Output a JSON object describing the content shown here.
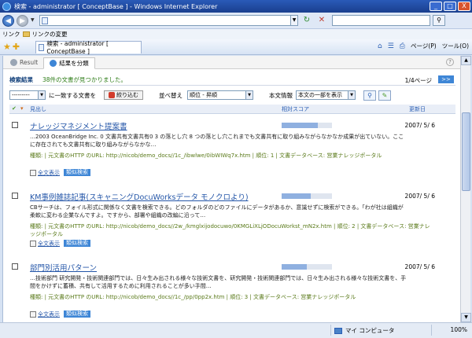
{
  "window": {
    "title": "検索 - administrator [ ConceptBase ] - Windows Internet Explorer",
    "minimize": "_",
    "maximize": "□",
    "close": "X"
  },
  "addressbar": {
    "back_icon": "back-arrow-icon",
    "url": "",
    "search_placeholder": ""
  },
  "linksbar": {
    "label": "リンク",
    "item": "リンクの変更"
  },
  "ie_tabs": {
    "active_tab": "検索 - administrator [ ConceptBase ]",
    "tools": [
      "ページ(P)",
      "ツール(O)"
    ]
  },
  "page_tabs": [
    {
      "label": "Result",
      "active": false
    },
    {
      "label": "結果を分類",
      "active": true
    }
  ],
  "summary": {
    "label": "検索結果",
    "message": "38件の文書が見つかりました。",
    "pages": "1/4ページ",
    "next": ">>"
  },
  "filters": {
    "match_select": "---------",
    "match_label": "に一致する文書を",
    "narrow_button": "絞り込む",
    "sort_label": "並べ替え",
    "sort_select": "順位 - 昇順",
    "body_label": "本文情報",
    "body_select": "本文の一部を表示"
  },
  "columns": {
    "heading": "見出し",
    "score": "相対スコア",
    "updated": "更新日"
  },
  "results": [
    {
      "title": "ナレッジマネジメント提案書",
      "score": 0.72,
      "date": "2007/ 5/ 6",
      "snippet": "…2003 OceanBridge Inc. 0 文書共有文書共有0 3 の落とし穴 8 つの落とし穴これまでも文書共有に取り組みながらなかなか成果が出ていない。ここに存在されても文書共有に取り組みながらなかな…",
      "meta": "種類: | 元文書のHTTP のURL: http://nicob/demo_docs//1c_/ibwlwe/0ibWIWq7x.htm | 順位: 1 | 文書データベース: 営業ナレッジポータル",
      "full_text": "全文表示",
      "similar": "類似検索"
    },
    {
      "title": "KM事例雑誌記事(スキャニングDocuWorksデータ モノクロより)",
      "score": 0.58,
      "date": "2007/ 5/ 6",
      "snippet": "CBサーチは、フォイル形式に関係なく文書を検索できる。どのフォルダのどのファイルにデータがあるか、意識せずに検索ができる。「わが社は組織が柔軟に変わる企業なんですよ。ですから、部署や組織の改編に沿って…",
      "meta": "種類: | 元文書のHTTP のURL: http://nicob/demo_docs//2w_/kmglxijodocuwo/0KMGLiXLjODocuWorkst_mN2x.htm | 順位: 2 | 文書データベース: 営業ナレッジポータル",
      "full_text": "全文表示",
      "similar": "類似検索"
    },
    {
      "title": "部門別活用パターン",
      "score": 0.5,
      "date": "2007/ 5/ 6",
      "snippet": "…技術部門 研究開発・技術関連部門では、日々生み出される様々な技術文書を、研究開発・技術関連部門では、日々生み出される様々な技術文書を、手間をかけずに蓄積、共有して活用するために利用されることが多い手間…",
      "meta": "種類: | 元文書のHTTP のURL: http://nicob/demo_docs//1c_/pp/0pp2x.htm | 順位: 3 | 文書データベース: 営業ナレッジポータル",
      "full_text": "全文表示",
      "similar": "類似検索"
    }
  ],
  "statusbar": {
    "zone": "マイ コンピュータ",
    "zoom": "100%"
  }
}
